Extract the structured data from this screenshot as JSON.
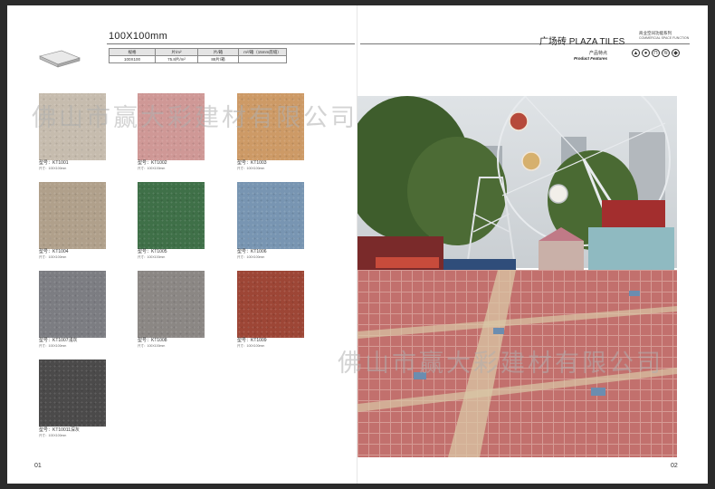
{
  "header": {
    "size_title": "100X100mm",
    "brand": "广场砖 PLAZA TILES",
    "series_cn": "商业空间功能系列",
    "series_en": "COMMERCIAL SPACE FUNCTION",
    "features_cn": "产品特点",
    "features_en": "Product Features",
    "feature_icons": [
      "anti-slip-icon",
      "water-drop-icon",
      "pressure-icon",
      "recycle-icon",
      "weather-icon"
    ]
  },
  "spec_table": {
    "headers": [
      "规格",
      "片/m²",
      "片/箱",
      "m²/箱（15mm底缝）"
    ],
    "row": [
      "100X100",
      "75.8片/m²",
      "88片/箱",
      ""
    ]
  },
  "tiles": [
    {
      "code": "型号：KT1001",
      "size": "尺寸：100X100mm",
      "color": "#c6bcae"
    },
    {
      "code": "型号：KT1002",
      "size": "尺寸：100X100mm",
      "color": "#cf9896"
    },
    {
      "code": "型号：KT1003",
      "size": "尺寸：100X100mm",
      "color": "#cd9a66"
    },
    {
      "code": "型号：KT1004",
      "size": "尺寸：100X100mm",
      "color": "#b0a08b"
    },
    {
      "code": "型号：KT1005",
      "size": "尺寸：100X100mm",
      "color": "#3f7048"
    },
    {
      "code": "型号：KT1006",
      "size": "尺寸：100X100mm",
      "color": "#7895b2"
    },
    {
      "code": "型号：KT1007浅灰",
      "size": "尺寸：100X100mm",
      "color": "#7c7d82"
    },
    {
      "code": "型号：KT1008",
      "size": "尺寸：100X100mm",
      "color": "#8b8784"
    },
    {
      "code": "型号：KT1009",
      "size": "尺寸：100X100mm",
      "color": "#9d4636"
    },
    {
      "code": "型号：KT10011深灰",
      "size": "尺寸：100X100mm",
      "color": "#4b4a4a"
    }
  ],
  "watermark": "佛山市赢大彩建材有限公司",
  "page_numbers": {
    "left": "01",
    "right": "02"
  }
}
